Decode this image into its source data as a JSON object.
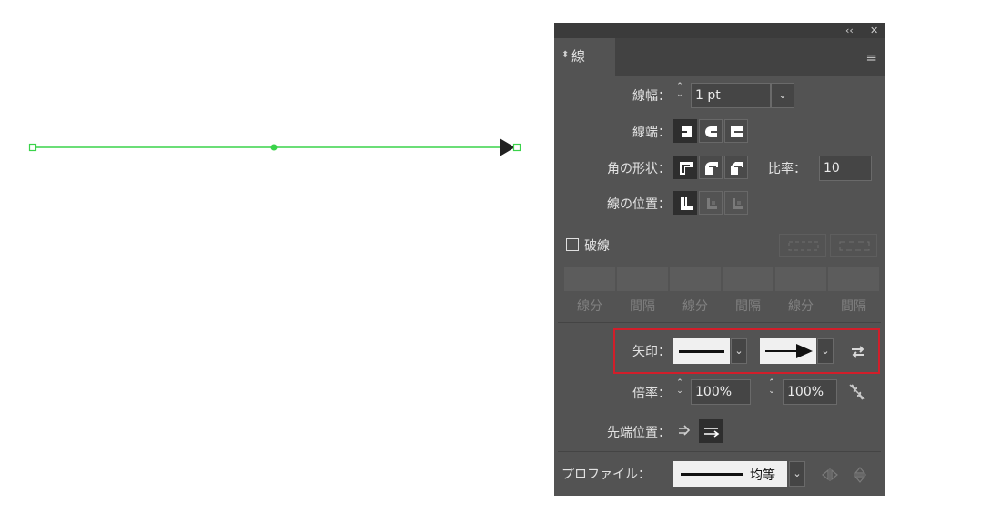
{
  "panel": {
    "title": "線",
    "collapse_glyph": "‹‹",
    "close_glyph": "✕",
    "menu_glyph": "≡",
    "weight": {
      "label": "線幅：",
      "value": "1 pt"
    },
    "cap": {
      "label": "線端："
    },
    "corner": {
      "label": "角の形状：",
      "limit_label": "比率：",
      "limit_value": "10"
    },
    "align": {
      "label": "線の位置："
    },
    "dashed": {
      "label": "破線",
      "checked": false,
      "fields": [
        {
          "label": "線分"
        },
        {
          "label": "間隔"
        },
        {
          "label": "線分"
        },
        {
          "label": "間隔"
        },
        {
          "label": "線分"
        },
        {
          "label": "間隔"
        }
      ]
    },
    "arrowheads": {
      "label": "矢印：",
      "start": "none",
      "end": "arrow"
    },
    "scale": {
      "label": "倍率：",
      "start": "100%",
      "end": "100%"
    },
    "align_arrow": {
      "label": "先端位置："
    },
    "profile": {
      "label": "プロファイル：",
      "value": "均等"
    }
  },
  "colors": {
    "panel_bg": "#535353",
    "path_green": "#3ad34a",
    "highlight_red": "#d21e2a"
  }
}
